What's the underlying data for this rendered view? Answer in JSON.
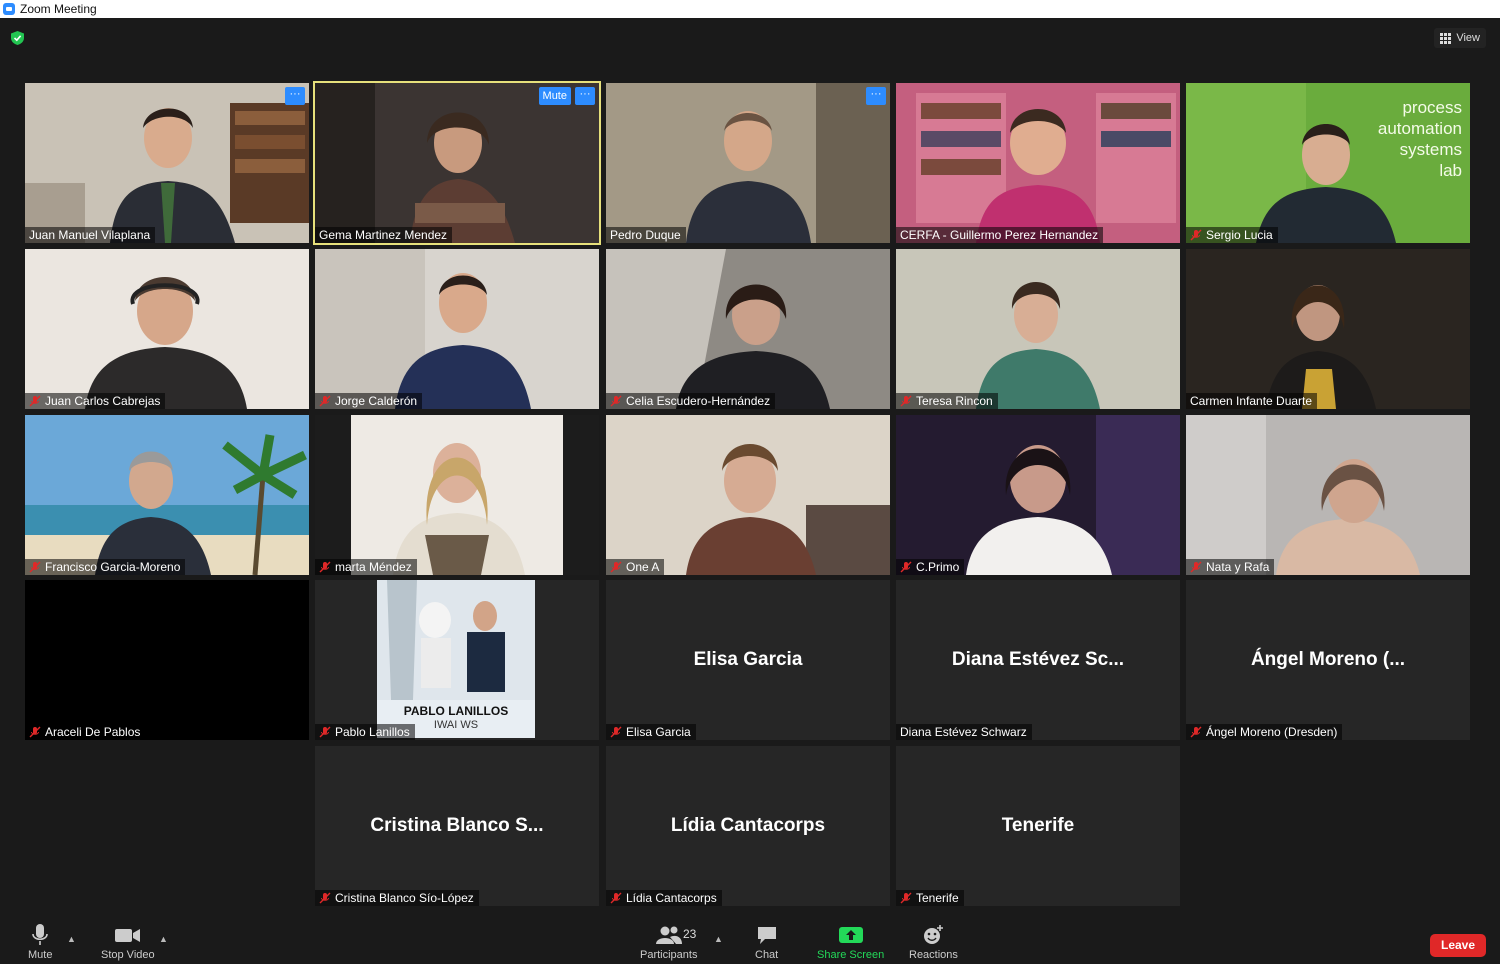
{
  "window": {
    "title": "Zoom Meeting"
  },
  "header": {
    "view_label": "View"
  },
  "participants": [
    {
      "name": "Juan Manuel Vilaplana",
      "muted": false,
      "menu": true
    },
    {
      "name": "Gema Martinez Mendez",
      "muted": false,
      "menu": true,
      "active_speaker": true,
      "mute_button": "Mute"
    },
    {
      "name": "Pedro Duque",
      "muted": false,
      "menu": true
    },
    {
      "name": "CERFA - Guillermo Perez Hernandez",
      "muted": false
    },
    {
      "name": "Sergio Lucia",
      "muted": true,
      "background_text": [
        "process",
        "automation",
        "systems",
        "lab"
      ]
    },
    {
      "name": "Juan Carlos Cabrejas",
      "muted": true
    },
    {
      "name": "Jorge Calderón",
      "muted": true
    },
    {
      "name": "Celia Escudero-Hernández",
      "muted": true
    },
    {
      "name": "Teresa Rincon",
      "muted": true
    },
    {
      "name": "Carmen Infante Duarte",
      "muted": false
    },
    {
      "name": "Francisco Garcia-Moreno",
      "muted": true
    },
    {
      "name": "marta Méndez",
      "muted": true
    },
    {
      "name": "One A",
      "muted": true
    },
    {
      "name": "C.Primo",
      "muted": true
    },
    {
      "name": "Nata y Rafa",
      "muted": true
    },
    {
      "name": "Araceli De Pablos",
      "muted": true
    },
    {
      "name": "Pablo Lanillos",
      "muted": true,
      "poster_text": [
        "PABLO LANILLOS",
        "IWAI WS"
      ]
    },
    {
      "name": "Elisa Garcia",
      "muted": true,
      "display_name": "Elisa Garcia"
    },
    {
      "name": "Diana Estévez Schwarz",
      "muted": false,
      "display_name": "Diana Estévez Sc..."
    },
    {
      "name": "Ángel Moreno (Dresden)",
      "muted": true,
      "display_name": "Ángel Moreno (..."
    },
    {
      "name": "Cristina Blanco Sío-López",
      "muted": true,
      "display_name": "Cristina Blanco S..."
    },
    {
      "name": "Lídia Cantacorps",
      "muted": true,
      "display_name": "Lídia Cantacorps"
    },
    {
      "name": "Tenerife",
      "muted": true,
      "display_name": "Tenerife"
    }
  ],
  "toolbar": {
    "mute": "Mute",
    "stop_video": "Stop Video",
    "participants": "Participants",
    "participant_count": "23",
    "chat": "Chat",
    "share_screen": "Share Screen",
    "reactions": "Reactions",
    "leave": "Leave"
  },
  "colors": {
    "accent": "#2d8cff",
    "share_green": "#23d959",
    "leave_red": "#e02828",
    "active_speaker": "#e6e07b",
    "muted_red": "#e02828"
  }
}
